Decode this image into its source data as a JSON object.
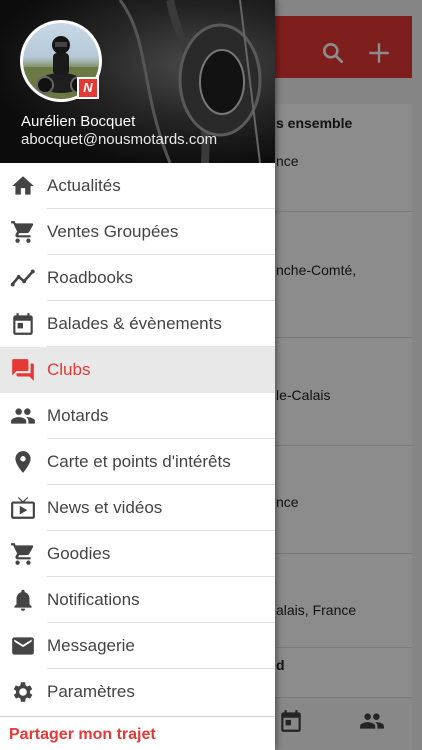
{
  "background": {
    "texts": [
      "s ensemble",
      "nce",
      "nche-Comté,",
      "le-Calais",
      "nce",
      "alais, France",
      "d"
    ],
    "actions": [
      "search-icon",
      "add-icon"
    ],
    "bottom_tabs": [
      "calendar-icon",
      "group-icon"
    ]
  },
  "drawer": {
    "user_name": "Aurélien Bocquet",
    "user_email": "abocquet@nousmotards.com",
    "badge": "N",
    "items": [
      {
        "label": "Actualités",
        "icon": "home-icon"
      },
      {
        "label": "Ventes Groupées",
        "icon": "cart-icon"
      },
      {
        "label": "Roadbooks",
        "icon": "trend-line-icon"
      },
      {
        "label": "Balades & évènements",
        "icon": "calendar-icon"
      },
      {
        "label": "Clubs",
        "icon": "chat-bubbles-icon",
        "active": true
      },
      {
        "label": "Motards",
        "icon": "people-icon"
      },
      {
        "label": "Carte et points d'intérêts",
        "icon": "location-pin-icon"
      },
      {
        "label": "News et vidéos",
        "icon": "tv-icon"
      },
      {
        "label": "Goodies",
        "icon": "cart-icon"
      },
      {
        "label": "Notifications",
        "icon": "bell-icon"
      },
      {
        "label": "Messagerie",
        "icon": "mail-icon"
      },
      {
        "label": "Paramètres",
        "icon": "settings-icon"
      }
    ],
    "share_label": "Partager mon trajet"
  },
  "colors": {
    "accent": "#e53935",
    "icon": "#444444",
    "active_bg": "#e8e8e8"
  }
}
